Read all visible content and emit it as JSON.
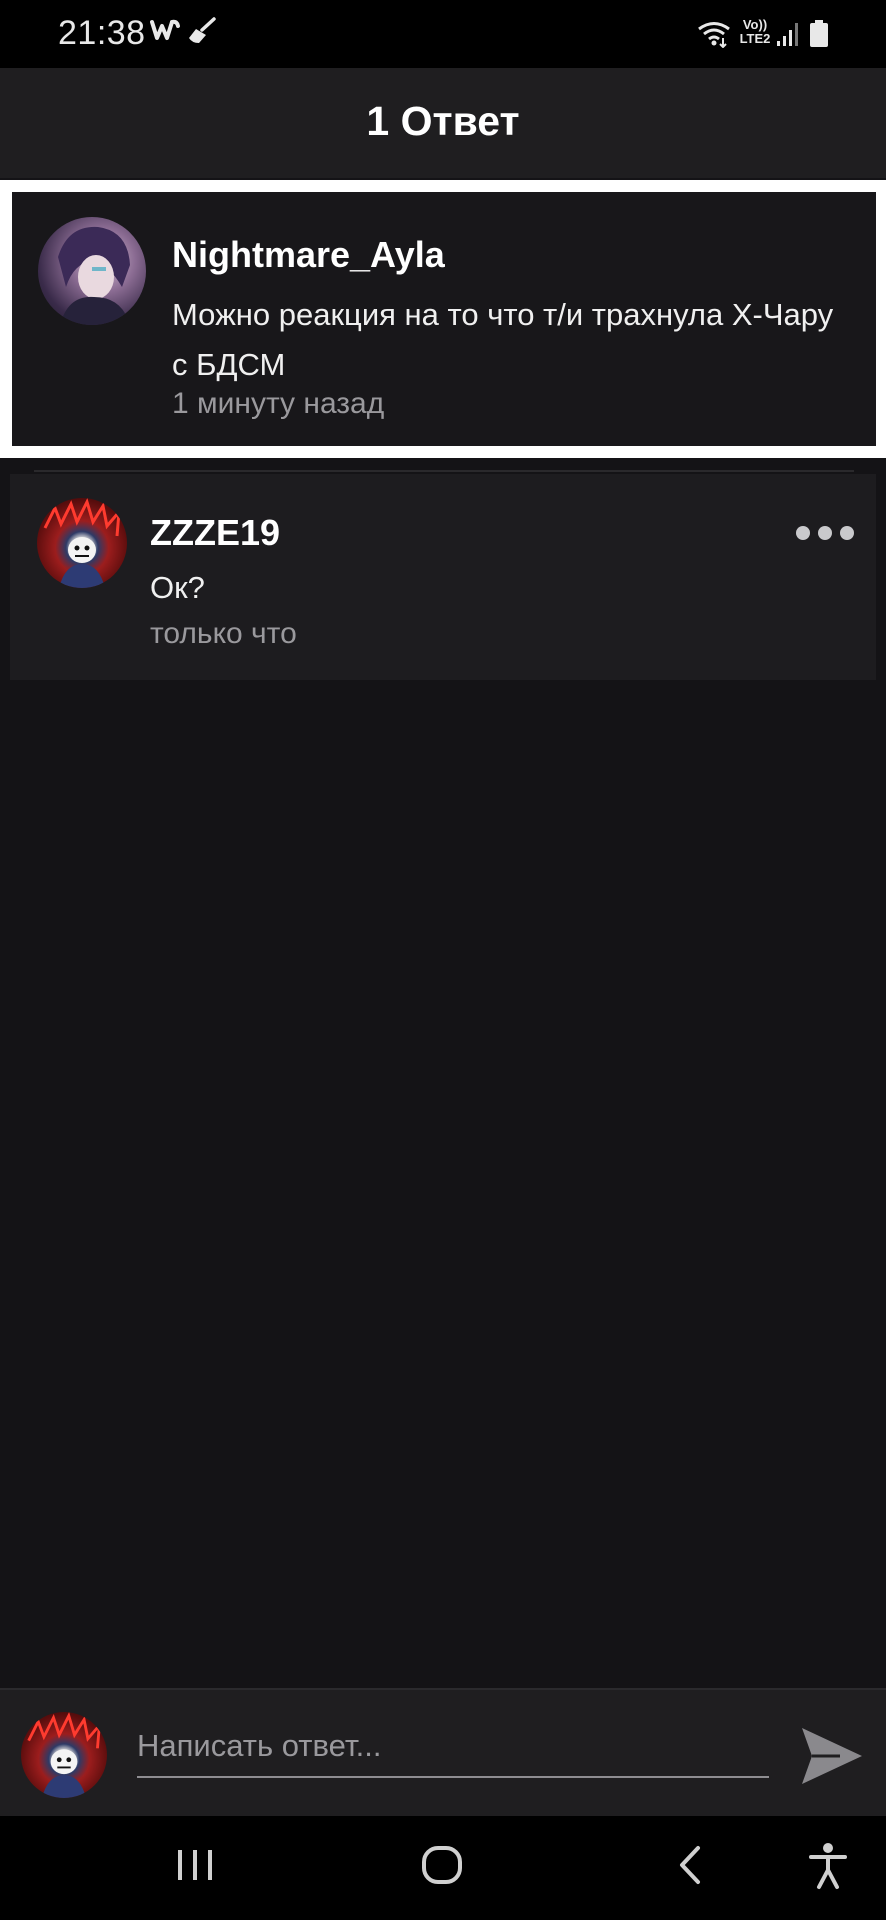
{
  "status_bar": {
    "time": "21:38",
    "app_icons": [
      "w-app-icon",
      "broom-icon"
    ],
    "network_label_line1": "Vo))",
    "network_label_line2": "LTE2",
    "icons": [
      "wifi-icon",
      "signal-icon",
      "battery-icon"
    ]
  },
  "header": {
    "title": "1 Ответ"
  },
  "parent_comment": {
    "username": "Nightmare_Ayla",
    "text": "Можно реакция на то что т/и трахнула Х-Чару с БДСМ",
    "time": "1 минуту назад"
  },
  "replies": [
    {
      "username": "ZZZE19",
      "text": "Ок?",
      "time": "только что",
      "menu_icon": "more-options-icon"
    }
  ],
  "compose": {
    "placeholder": "Написать ответ...",
    "send_icon": "send-icon"
  },
  "nav_bar": {
    "icons": [
      "recent-apps-icon",
      "home-icon",
      "back-icon",
      "accessibility-icon"
    ]
  },
  "colors": {
    "background": "#141316",
    "header": "#1f1e20",
    "card": "#1d1c1f",
    "highlight_border": "#ffffff",
    "secondary_text": "#9a999d"
  }
}
